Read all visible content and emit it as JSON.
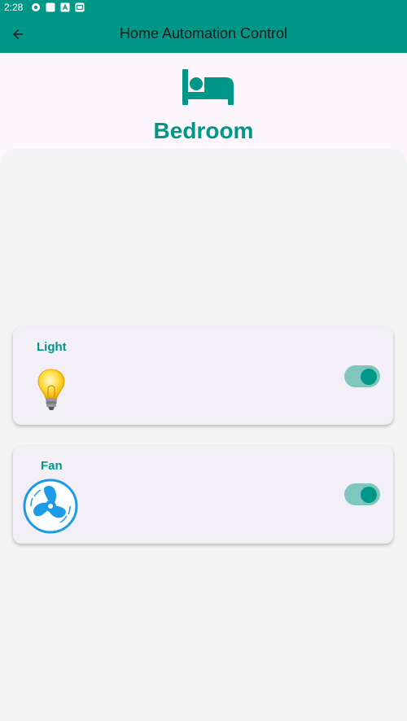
{
  "status_bar": {
    "time": "2:28",
    "icons": [
      "notification-icon",
      "square-icon",
      "a-icon",
      "box-icon"
    ]
  },
  "app_bar": {
    "title": "Home Automation Control",
    "back_icon": "arrow-left-icon"
  },
  "room": {
    "icon": "bed-icon",
    "name": "Bedroom"
  },
  "devices": [
    {
      "label": "Light",
      "icon": "lightbulb-icon",
      "on": true
    },
    {
      "label": "Fan",
      "icon": "fan-icon",
      "on": true
    }
  ],
  "colors": {
    "primary": "#009688",
    "toggle_track": "#7fc6bf",
    "card_bg": "#f3eff6",
    "content_bg": "#f4f4f4",
    "header_bg": "#fdf7fd",
    "fan_blue": "#1e9be8"
  }
}
